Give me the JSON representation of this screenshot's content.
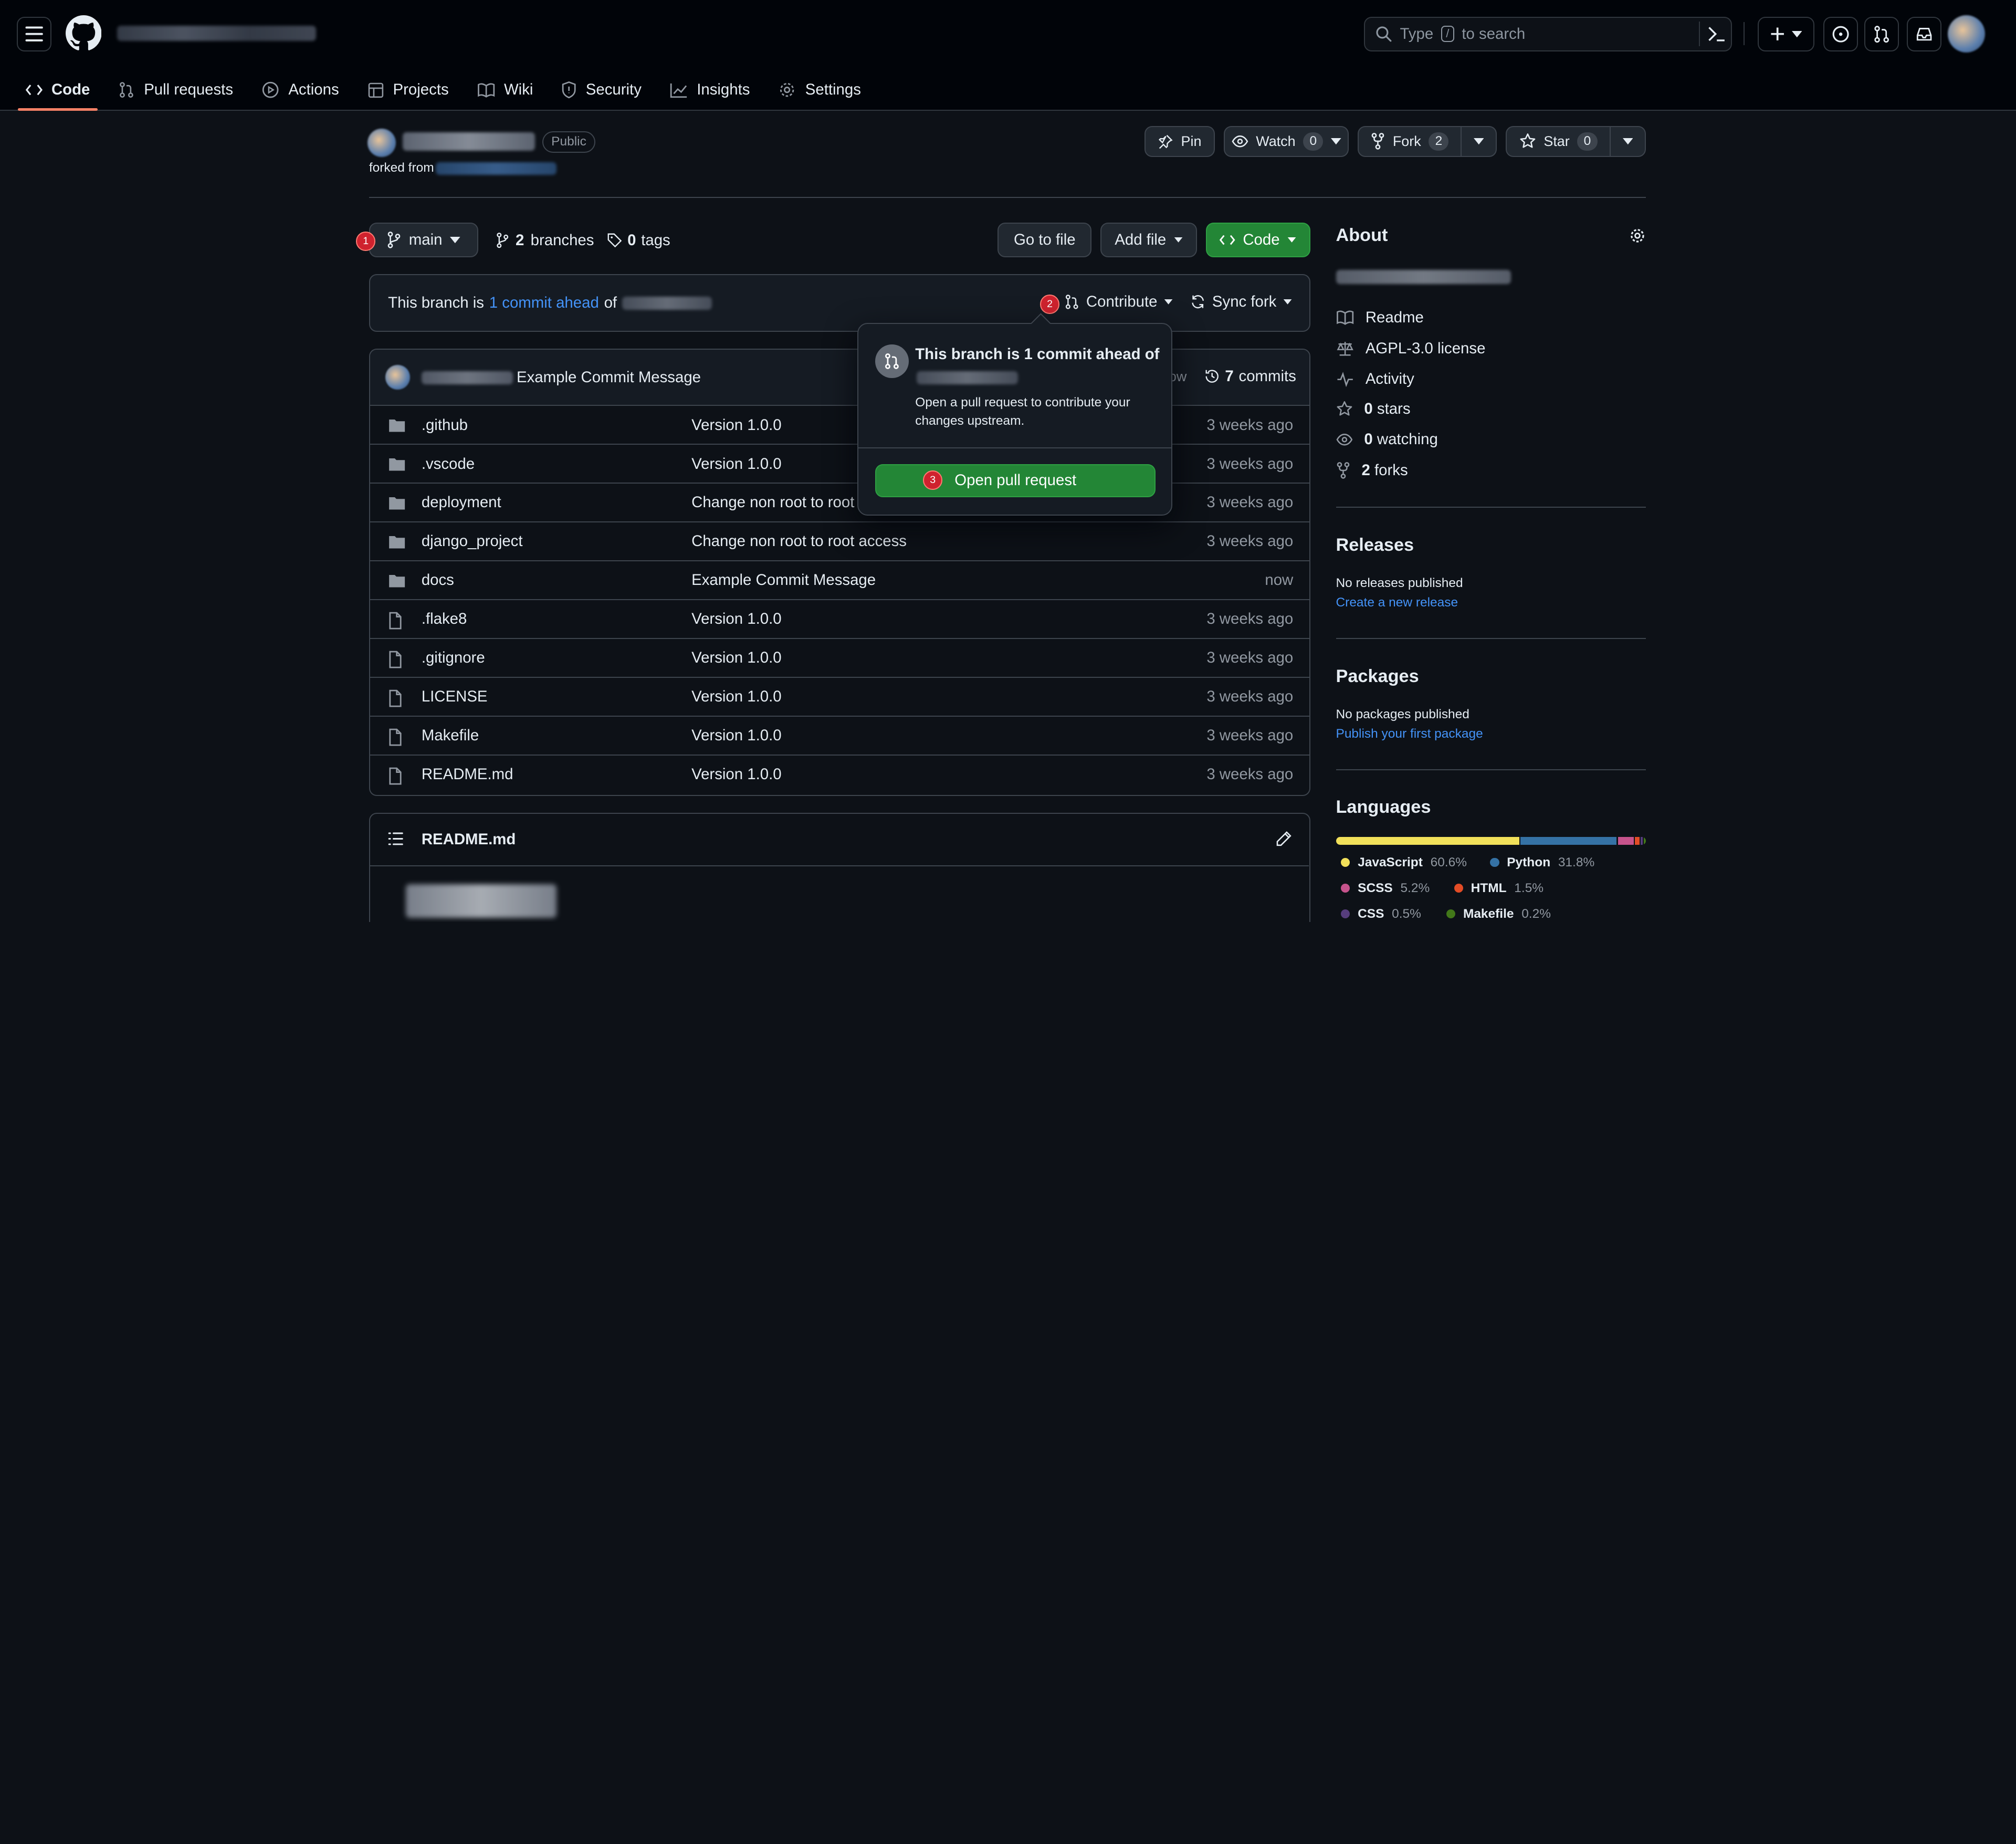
{
  "header": {
    "search_placeholder": "Type",
    "search_key": "/",
    "search_suffix": "to search"
  },
  "nav": {
    "tabs": [
      {
        "label": "Code"
      },
      {
        "label": "Pull requests"
      },
      {
        "label": "Actions"
      },
      {
        "label": "Projects"
      },
      {
        "label": "Wiki"
      },
      {
        "label": "Security"
      },
      {
        "label": "Insights"
      },
      {
        "label": "Settings"
      }
    ]
  },
  "repo": {
    "visibility": "Public",
    "forked_from_label": "forked from",
    "pin_label": "Pin",
    "watch_label": "Watch",
    "watch_count": "0",
    "fork_label": "Fork",
    "fork_count": "2",
    "star_label": "Star",
    "star_count": "0"
  },
  "toolbar": {
    "branch": "main",
    "branches_count": "2",
    "branches_label": "branches",
    "tags_count": "0",
    "tags_label": "tags",
    "go_to_file": "Go to file",
    "add_file": "Add file",
    "code": "Code"
  },
  "branch_banner": {
    "prefix": "This branch is",
    "ahead_link": "1 commit ahead",
    "of": "of",
    "contribute": "Contribute",
    "sync_fork": "Sync fork"
  },
  "badges": {
    "b1": "1",
    "b2": "2",
    "b3": "3"
  },
  "popover": {
    "title": "This branch is 1 commit ahead of",
    "body": "Open a pull request to contribute your changes upstream.",
    "button": "Open pull request"
  },
  "commit": {
    "message": "Example Commit Message",
    "time": "now",
    "commits_count": "7",
    "commits_label": "commits"
  },
  "files": [
    {
      "name": ".github",
      "type": "folder",
      "message": "Version 1.0.0",
      "time": "3 weeks ago"
    },
    {
      "name": ".vscode",
      "type": "folder",
      "message": "Version 1.0.0",
      "time": "3 weeks ago"
    },
    {
      "name": "deployment",
      "type": "folder",
      "message": "Change non root to root access",
      "time": "3 weeks ago"
    },
    {
      "name": "django_project",
      "type": "folder",
      "message": "Change non root to root access",
      "time": "3 weeks ago"
    },
    {
      "name": "docs",
      "type": "folder",
      "message": "Example Commit Message",
      "time": "now"
    },
    {
      "name": ".flake8",
      "type": "file",
      "message": "Version 1.0.0",
      "time": "3 weeks ago"
    },
    {
      "name": ".gitignore",
      "type": "file",
      "message": "Version 1.0.0",
      "time": "3 weeks ago"
    },
    {
      "name": "LICENSE",
      "type": "file",
      "message": "Version 1.0.0",
      "time": "3 weeks ago"
    },
    {
      "name": "Makefile",
      "type": "file",
      "message": "Version 1.0.0",
      "time": "3 weeks ago"
    },
    {
      "name": "README.md",
      "type": "file",
      "message": "Version 1.0.0",
      "time": "3 weeks ago"
    }
  ],
  "readme": {
    "title": "README.md"
  },
  "about": {
    "title": "About",
    "readme": "Readme",
    "license": "AGPL-3.0 license",
    "activity": "Activity",
    "stars_count": "0",
    "stars_label": "stars",
    "watching_count": "0",
    "watching_label": "watching",
    "forks_count": "2",
    "forks_label": "forks"
  },
  "releases": {
    "title": "Releases",
    "empty": "No releases published",
    "link": "Create a new release"
  },
  "packages": {
    "title": "Packages",
    "empty": "No packages published",
    "link": "Publish your first package"
  },
  "languages": {
    "title": "Languages",
    "items": [
      {
        "name": "JavaScript",
        "percent": "60.6%",
        "value": 60.6,
        "color": "#f1e05a"
      },
      {
        "name": "Python",
        "percent": "31.8%",
        "value": 31.8,
        "color": "#3572A5"
      },
      {
        "name": "SCSS",
        "percent": "5.2%",
        "value": 5.2,
        "color": "#c6538c"
      },
      {
        "name": "HTML",
        "percent": "1.5%",
        "value": 1.5,
        "color": "#e34c26"
      },
      {
        "name": "CSS",
        "percent": "0.5%",
        "value": 0.5,
        "color": "#563d7c"
      },
      {
        "name": "Makefile",
        "percent": "0.2%",
        "value": 0.2,
        "color": "#427819"
      }
    ]
  }
}
